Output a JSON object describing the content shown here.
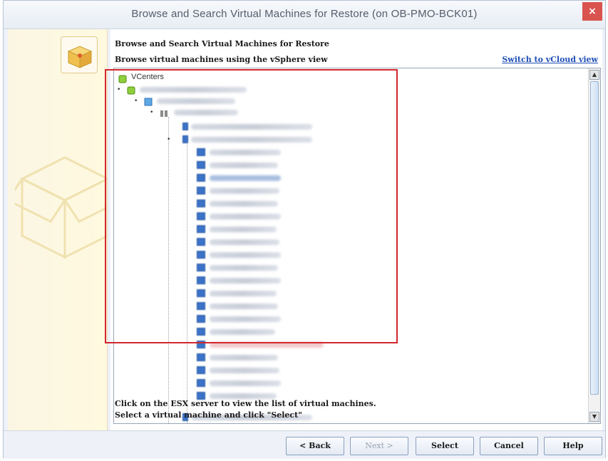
{
  "window": {
    "title": "Browse and Search Virtual Machines for Restore  (on OB-PMO-BCK01)",
    "close_label": "×"
  },
  "content": {
    "heading": "Browse and Search Virtual Machines for Restore",
    "subheading": "Browse virtual machines using the vSphere view",
    "switch_link": "Switch to vCloud view"
  },
  "tree": {
    "root_label": "VCenters"
  },
  "hints": {
    "line1": "Click on the ESX server to view the list of virtual machines.",
    "line2": "Select a virtual machine and click \"Select\""
  },
  "buttons": {
    "back": "< Back",
    "next": "Next >",
    "select": "Select",
    "cancel": "Cancel",
    "help": "Help"
  },
  "colors": {
    "highlight_frame": "#d2272d",
    "link": "#1f4fb5",
    "close": "#d9534f"
  }
}
